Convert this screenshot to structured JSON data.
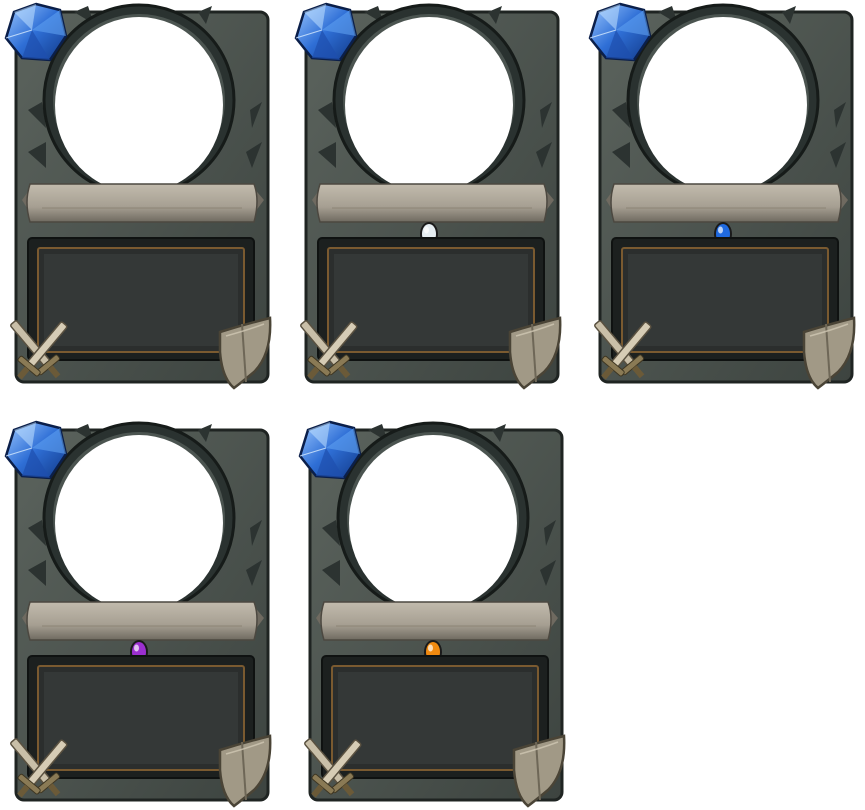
{
  "sheet": {
    "background": "#ffffff"
  },
  "palette": {
    "frame": "#3d4440",
    "frame_edge": "#1f2422",
    "frame_light": "#5b635d",
    "ring": "#2a3230",
    "spike": "#2c3331",
    "banner": "#a69f92",
    "banner_shadow": "#6f6a60",
    "textbox": "#2b2e2d",
    "trim": "#7a5a30",
    "mana_gem": "#2f6fd6",
    "mana_gem_light": "#9cc8ff",
    "attack_blade": "#c9bfa8",
    "shield": "#a19986"
  },
  "cards": [
    {
      "id": "card-1",
      "rarity": "free",
      "rarity_gem": "none"
    },
    {
      "id": "card-2",
      "rarity": "common",
      "rarity_gem": "#e6eef2"
    },
    {
      "id": "card-3",
      "rarity": "rare",
      "rarity_gem": "#1f6ae0"
    },
    {
      "id": "card-4",
      "rarity": "epic",
      "rarity_gem": "#9b2fd0"
    },
    {
      "id": "card-5",
      "rarity": "legendary",
      "rarity_gem": "#f08a10"
    }
  ],
  "icons": {
    "mana": "mana-gem-icon",
    "attack": "crossed-swords-icon",
    "health": "shield-icon",
    "rarity": "rarity-gem-icon"
  }
}
